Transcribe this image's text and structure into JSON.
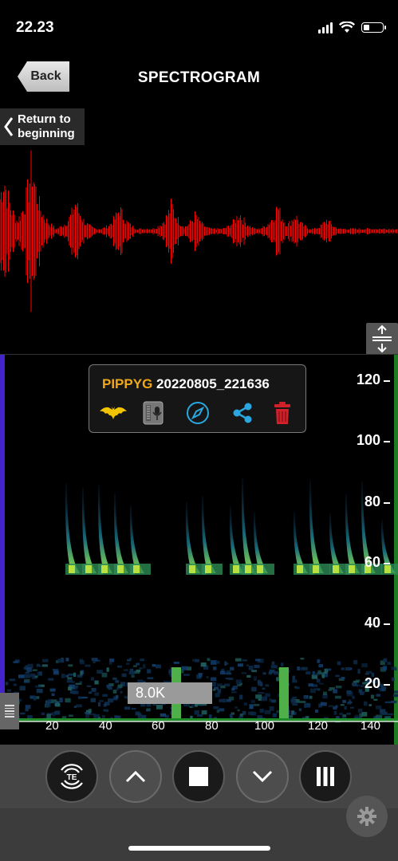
{
  "status": {
    "time": "22.23"
  },
  "nav": {
    "back_label": "Back",
    "title": "SPECTROGRAM",
    "return_label_line1": "Return to",
    "return_label_line2": "beginning"
  },
  "recording": {
    "species": "PIPPYG",
    "filename": "20220805_221636"
  },
  "popup_icons": [
    "bat-icon",
    "recorder-icon",
    "compass-icon",
    "share-icon",
    "trash-icon"
  ],
  "freq_axis": {
    "ticks": [
      "120",
      "100",
      "80",
      "60",
      "40",
      "20"
    ]
  },
  "time_axis": {
    "ticks": [
      "20",
      "40",
      "60",
      "80",
      "100",
      "120",
      "140"
    ]
  },
  "freq_tag": "8.0K",
  "toolbar": {
    "te_label": "TE"
  },
  "colors": {
    "waveform": "#ff0000",
    "species": "#f0a818",
    "accent_blue": "#2aa7e0",
    "trash": "#d0202a",
    "bat": "#f2c400",
    "left_edge": "#4422cc"
  }
}
